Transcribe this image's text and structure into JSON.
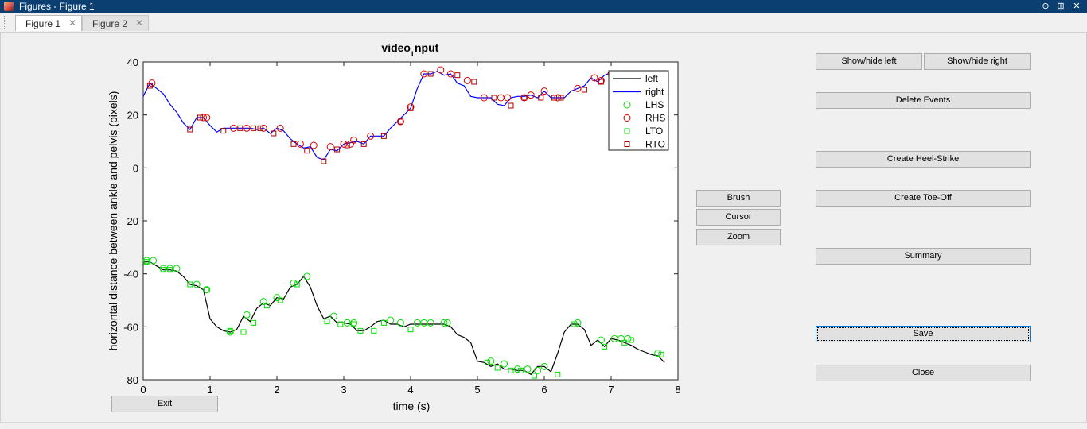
{
  "window": {
    "title": "Figures - Figure 1",
    "controls": [
      "⊙",
      "⊞",
      "✕"
    ]
  },
  "tabs": [
    {
      "label": "Figure 1",
      "active": true
    },
    {
      "label": "Figure 2",
      "active": false
    }
  ],
  "buttons": {
    "show_left": "Show/hide left",
    "show_right": "Show/hide right",
    "delete_events": "Delete Events",
    "create_heel_strike": "Create Heel-Strike",
    "create_toe_off": "Create Toe-Off",
    "summary": "Summary",
    "save": "Save",
    "close": "Close",
    "brush": "Brush",
    "cursor": "Cursor",
    "zoom": "Zoom",
    "exit": "Exit"
  },
  "colors": {
    "left": "#000000",
    "right": "#0000ff",
    "lhs": "#00dd00",
    "rhs": "#dd0000",
    "lto": "#00dd00",
    "rto": "#aa0000"
  },
  "chart_data": {
    "type": "line",
    "title_main": "video",
    "title_sub": "i",
    "title_rest": "nput",
    "xlabel": "time (s)",
    "ylabel": "horizontal distance between ankle and pelvis (pixels)",
    "xlim": [
      0,
      8
    ],
    "ylim": [
      -80,
      40
    ],
    "xticks": [
      0,
      1,
      2,
      3,
      4,
      5,
      6,
      7,
      8
    ],
    "yticks": [
      40,
      20,
      0,
      -20,
      -40,
      -60,
      -80
    ],
    "legend": [
      "left",
      "right",
      "LHS",
      "RHS",
      "LTO",
      "RTO"
    ],
    "legend_position": "top-right",
    "series": [
      {
        "name": "left",
        "x": [
          0,
          0.1,
          0.2,
          0.3,
          0.4,
          0.5,
          0.6,
          0.7,
          0.8,
          0.9,
          1.0,
          1.1,
          1.2,
          1.3,
          1.4,
          1.5,
          1.6,
          1.7,
          1.8,
          1.9,
          2.0,
          2.1,
          2.2,
          2.3,
          2.4,
          2.5,
          2.6,
          2.7,
          2.8,
          2.9,
          3.0,
          3.1,
          3.2,
          3.3,
          3.4,
          3.5,
          3.6,
          3.7,
          3.8,
          3.9,
          4.0,
          4.1,
          4.2,
          4.3,
          4.4,
          4.5,
          4.6,
          4.7,
          4.8,
          4.9,
          5.0,
          5.1,
          5.2,
          5.3,
          5.4,
          5.5,
          5.6,
          5.7,
          5.8,
          5.9,
          6.0,
          6.1,
          6.2,
          6.3,
          6.4,
          6.5,
          6.6,
          6.7,
          6.8,
          6.9,
          7.0,
          7.1,
          7.2,
          7.3,
          7.4,
          7.5,
          7.6,
          7.7,
          7.8
        ],
        "y": [
          -35.5,
          -35.5,
          -37,
          -38.5,
          -38.5,
          -39,
          -41,
          -44,
          -44.5,
          -46,
          -57,
          -60,
          -61.5,
          -62,
          -61,
          -56,
          -58,
          -53,
          -51,
          -52,
          -49,
          -49.5,
          -45,
          -44,
          -41,
          -45,
          -52,
          -57,
          -56,
          -58.5,
          -58.5,
          -59,
          -61.5,
          -61.5,
          -60,
          -58,
          -57.5,
          -59,
          -59,
          -60,
          -59,
          -59,
          -59,
          -59,
          -59,
          -59,
          -60,
          -63,
          -64,
          -66,
          -73,
          -73.5,
          -75,
          -74,
          -76,
          -76,
          -76.5,
          -76.5,
          -78,
          -75,
          -75,
          -77,
          -70,
          -62,
          -59,
          -59,
          -61,
          -67,
          -65,
          -67.5,
          -64.5,
          -65,
          -66,
          -67,
          -68.5,
          -69.5,
          -70.5,
          -71,
          -73.5
        ]
      },
      {
        "name": "right",
        "x": [
          0,
          0.1,
          0.2,
          0.3,
          0.4,
          0.5,
          0.6,
          0.7,
          0.8,
          0.9,
          1.0,
          1.1,
          1.2,
          1.3,
          1.4,
          1.5,
          1.6,
          1.7,
          1.8,
          1.9,
          2.0,
          2.1,
          2.2,
          2.3,
          2.4,
          2.5,
          2.6,
          2.7,
          2.8,
          2.9,
          3.0,
          3.1,
          3.2,
          3.3,
          3.4,
          3.5,
          3.6,
          3.7,
          3.8,
          3.9,
          4.0,
          4.1,
          4.2,
          4.3,
          4.4,
          4.5,
          4.6,
          4.7,
          4.8,
          4.9,
          5.0,
          5.1,
          5.2,
          5.3,
          5.4,
          5.5,
          5.6,
          5.7,
          5.8,
          5.9,
          6.0,
          6.1,
          6.2,
          6.3,
          6.4,
          6.5,
          6.6,
          6.7,
          6.8,
          6.9,
          7.0,
          7.1
        ],
        "y": [
          27,
          32,
          30,
          28,
          24,
          21,
          17,
          14.5,
          19,
          19,
          16,
          13.5,
          15,
          15,
          15,
          15,
          15,
          14.5,
          15,
          13,
          15,
          14,
          11,
          9,
          7.5,
          8,
          4,
          3,
          7,
          6.5,
          9,
          9.5,
          10,
          9,
          12,
          12,
          12,
          15,
          17.5,
          20,
          22.5,
          30,
          35.5,
          35.5,
          36.5,
          35,
          35.5,
          32,
          31,
          27,
          26.5,
          26.5,
          26.5,
          24,
          23.5,
          26.5,
          27,
          27,
          27.5,
          26.5,
          29,
          26.5,
          26.5,
          26.5,
          29,
          30,
          31,
          34,
          32.5,
          35,
          36,
          36
        ]
      }
    ],
    "events": {
      "LHS": [
        [
          0.05,
          -35
        ],
        [
          0.15,
          -35
        ],
        [
          0.3,
          -38
        ],
        [
          0.4,
          -38
        ],
        [
          0.5,
          -38
        ],
        [
          0.8,
          -44
        ],
        [
          0.95,
          -46
        ],
        [
          1.3,
          -62
        ],
        [
          1.55,
          -55.5
        ],
        [
          1.8,
          -50.5
        ],
        [
          2.0,
          -49
        ],
        [
          2.25,
          -43.5
        ],
        [
          2.45,
          -41
        ],
        [
          2.85,
          -56
        ],
        [
          3.05,
          -58.5
        ],
        [
          3.15,
          -58.5
        ],
        [
          3.7,
          -57.5
        ],
        [
          3.85,
          -58.5
        ],
        [
          4.1,
          -58.5
        ],
        [
          4.2,
          -58.5
        ],
        [
          4.3,
          -58.5
        ],
        [
          4.5,
          -58.5
        ],
        [
          4.55,
          -58.5
        ],
        [
          5.2,
          -73
        ],
        [
          5.4,
          -74
        ],
        [
          5.6,
          -76
        ],
        [
          5.75,
          -76
        ],
        [
          5.9,
          -76.5
        ],
        [
          6.0,
          -75
        ],
        [
          6.5,
          -58.5
        ],
        [
          6.85,
          -65
        ],
        [
          7.05,
          -64.5
        ],
        [
          7.15,
          -64.5
        ],
        [
          7.25,
          -64.5
        ],
        [
          7.7,
          -70
        ]
      ],
      "RHS": [
        [
          0.13,
          32
        ],
        [
          0.9,
          19
        ],
        [
          0.95,
          19
        ],
        [
          1.35,
          15
        ],
        [
          1.55,
          15
        ],
        [
          1.8,
          15
        ],
        [
          2.05,
          15
        ],
        [
          2.35,
          9
        ],
        [
          2.55,
          8.5
        ],
        [
          2.8,
          8
        ],
        [
          3.0,
          9
        ],
        [
          3.1,
          9
        ],
        [
          3.15,
          10.5
        ],
        [
          3.4,
          12
        ],
        [
          3.85,
          17.5
        ],
        [
          4.0,
          23
        ],
        [
          4.2,
          35.5
        ],
        [
          4.45,
          37
        ],
        [
          4.6,
          35.5
        ],
        [
          4.85,
          33
        ],
        [
          5.1,
          26.5
        ],
        [
          5.35,
          26.5
        ],
        [
          5.45,
          26.5
        ],
        [
          5.7,
          26.5
        ],
        [
          5.8,
          27.5
        ],
        [
          6.0,
          29
        ],
        [
          6.2,
          26.5
        ],
        [
          6.5,
          30
        ],
        [
          6.75,
          34
        ],
        [
          6.85,
          33
        ],
        [
          7.0,
          35.5
        ]
      ],
      "LTO": [
        [
          0.05,
          -35.5
        ],
        [
          0.3,
          -38.5
        ],
        [
          0.4,
          -38.5
        ],
        [
          0.7,
          -44
        ],
        [
          0.95,
          -46
        ],
        [
          1.3,
          -61.5
        ],
        [
          1.5,
          -62
        ],
        [
          1.65,
          -58.5
        ],
        [
          1.85,
          -52
        ],
        [
          2.05,
          -50
        ],
        [
          2.3,
          -44
        ],
        [
          2.75,
          -58
        ],
        [
          2.95,
          -59
        ],
        [
          3.15,
          -59
        ],
        [
          3.25,
          -61.5
        ],
        [
          3.45,
          -61.5
        ],
        [
          3.6,
          -58.5
        ],
        [
          4.0,
          -61
        ],
        [
          5.15,
          -73.5
        ],
        [
          5.3,
          -75.5
        ],
        [
          5.5,
          -76.5
        ],
        [
          5.65,
          -76.5
        ],
        [
          5.85,
          -78.5
        ],
        [
          6.2,
          -78
        ],
        [
          6.45,
          -59
        ],
        [
          6.9,
          -67.5
        ],
        [
          7.2,
          -66
        ],
        [
          7.3,
          -65
        ],
        [
          7.75,
          -70.5
        ]
      ],
      "RTO": [
        [
          0.1,
          31
        ],
        [
          0.7,
          14.5
        ],
        [
          0.85,
          19
        ],
        [
          1.2,
          14
        ],
        [
          1.45,
          15
        ],
        [
          1.65,
          15
        ],
        [
          1.75,
          15
        ],
        [
          1.95,
          13
        ],
        [
          2.25,
          9
        ],
        [
          2.45,
          6.5
        ],
        [
          2.7,
          2.5
        ],
        [
          2.9,
          7
        ],
        [
          3.05,
          8.5
        ],
        [
          3.3,
          9
        ],
        [
          3.6,
          12
        ],
        [
          3.85,
          17.5
        ],
        [
          4.0,
          22.5
        ],
        [
          4.3,
          35.5
        ],
        [
          4.7,
          35
        ],
        [
          4.95,
          32.5
        ],
        [
          5.25,
          26.5
        ],
        [
          5.5,
          23.5
        ],
        [
          5.7,
          26.5
        ],
        [
          5.95,
          26.5
        ],
        [
          6.15,
          26.5
        ],
        [
          6.25,
          26.5
        ],
        [
          6.6,
          29.5
        ],
        [
          6.85,
          32.5
        ]
      ]
    }
  }
}
